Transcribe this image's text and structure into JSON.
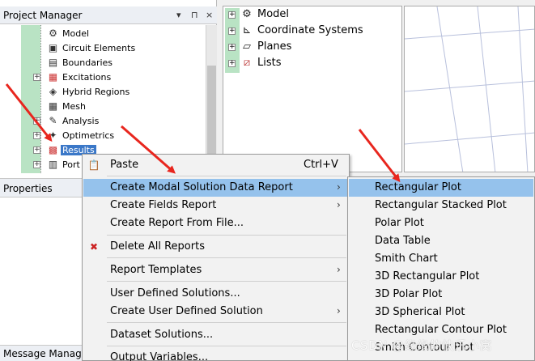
{
  "project_manager": {
    "title": "Project Manager",
    "pin": "▾ ⊓ ×",
    "tree": [
      {
        "label": "Model",
        "icon": "model-icon",
        "expander": false
      },
      {
        "label": "Circuit Elements",
        "icon": "circuit-elements-icon",
        "expander": false
      },
      {
        "label": "Boundaries",
        "icon": "boundaries-icon",
        "expander": false
      },
      {
        "label": "Excitations",
        "icon": "excitations-icon",
        "expander": true
      },
      {
        "label": "Hybrid Regions",
        "icon": "hybrid-regions-icon",
        "expander": false
      },
      {
        "label": "Mesh",
        "icon": "mesh-icon",
        "expander": false
      },
      {
        "label": "Analysis",
        "icon": "analysis-icon",
        "expander": true
      },
      {
        "label": "Optimetrics",
        "icon": "optimetrics-icon",
        "expander": true
      },
      {
        "label": "Results",
        "icon": "results-icon",
        "expander": true,
        "selected": true
      },
      {
        "label": "Port",
        "icon": "port-icon",
        "expander": true
      }
    ]
  },
  "properties": {
    "title": "Properties"
  },
  "message_manager": {
    "title": "Message Manager"
  },
  "model_tree": [
    {
      "label": "Model",
      "icon": "model-icon"
    },
    {
      "label": "Coordinate Systems",
      "icon": "coordinate-systems-icon"
    },
    {
      "label": "Planes",
      "icon": "planes-icon"
    },
    {
      "label": "Lists",
      "icon": "lists-icon"
    }
  ],
  "context_menu": [
    {
      "label": "Paste",
      "shortcut": "Ctrl+V",
      "icon": "paste-icon"
    },
    {
      "label": "Create Modal Solution Data Report",
      "submenu": true,
      "highlighted": true
    },
    {
      "label": "Create Fields Report",
      "submenu": true
    },
    {
      "label": "Create Report From File..."
    },
    {
      "label": "Delete All Reports",
      "icon": "delete-reports-icon"
    },
    {
      "label": "Report Templates",
      "submenu": true
    },
    {
      "label": "User Defined Solutions..."
    },
    {
      "label": "Create User Defined Solution",
      "submenu": true
    },
    {
      "label": "Dataset Solutions..."
    },
    {
      "label": "Output Variables..."
    }
  ],
  "submenu": [
    {
      "label": "Rectangular Plot",
      "highlighted": true
    },
    {
      "label": "Rectangular Stacked Plot"
    },
    {
      "label": "Polar Plot"
    },
    {
      "label": "Data Table"
    },
    {
      "label": "Smith Chart"
    },
    {
      "label": "3D Rectangular Plot"
    },
    {
      "label": "3D Polar Plot"
    },
    {
      "label": "3D Spherical Plot"
    },
    {
      "label": "Rectangular Contour Plot"
    },
    {
      "label": "Smith Contour Plot"
    }
  ],
  "watermark": "CSDN @缘缘的快乐小窝",
  "colors": {
    "highlight": "#95c2ec",
    "selection": "#3b78c8",
    "arrow": "#e8261e",
    "tree_bar": "#b9e3c4"
  }
}
